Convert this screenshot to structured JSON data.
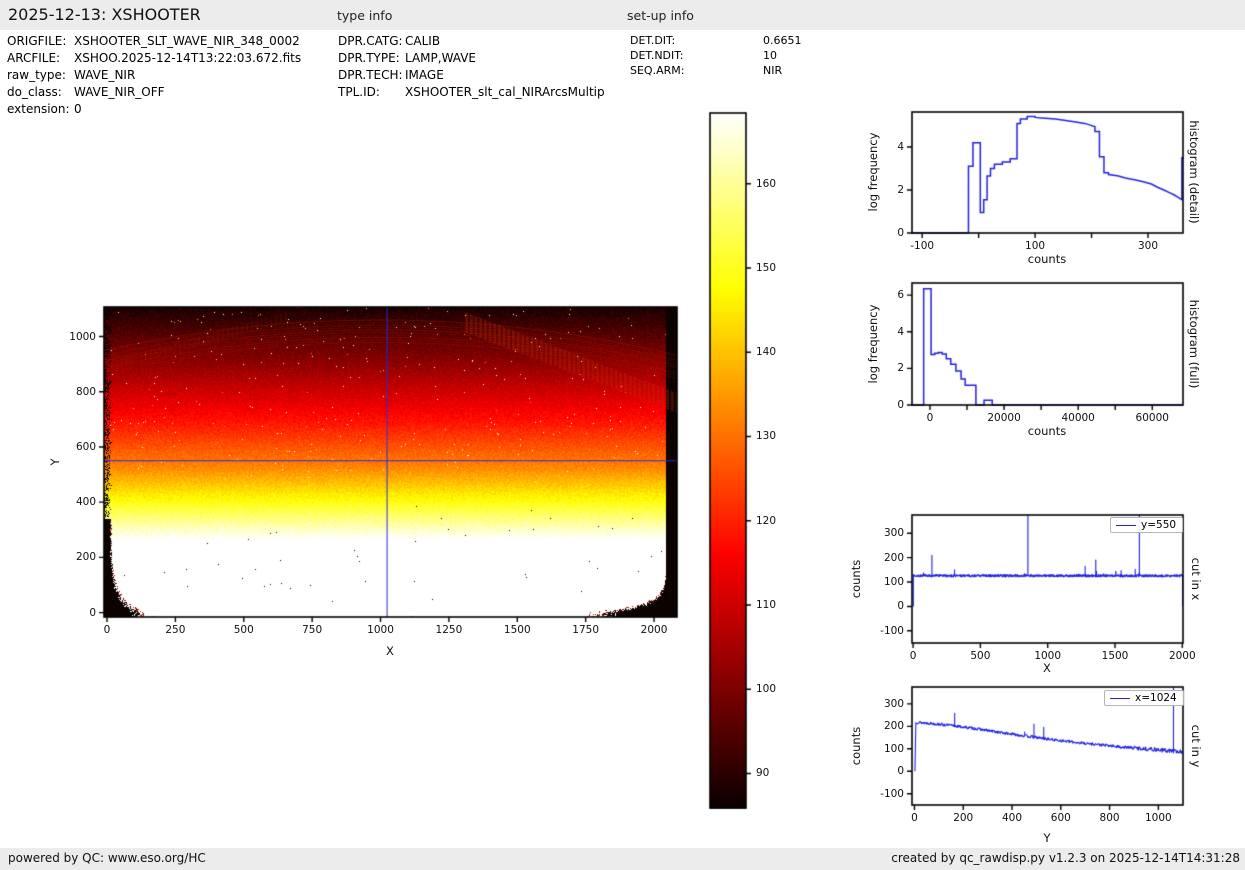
{
  "header": {
    "title": "2025-12-13: XSHOOTER",
    "type_info_title": "type info",
    "setup_info_title": "set-up info"
  },
  "file_info": {
    "rows": [
      {
        "label": "ORIGFILE:",
        "value": "XSHOOTER_SLT_WAVE_NIR_348_0002"
      },
      {
        "label": "ARCFILE:",
        "value": "XSHOO.2025-12-14T13:22:03.672.fits"
      },
      {
        "label": "raw_type:",
        "value": "WAVE_NIR"
      },
      {
        "label": "do_class:",
        "value": "WAVE_NIR_OFF"
      },
      {
        "label": "extension:",
        "value": "0"
      }
    ]
  },
  "type_info": {
    "rows": [
      {
        "label": "DPR.CATG:",
        "value": "CALIB"
      },
      {
        "label": "DPR.TYPE:",
        "value": "LAMP,WAVE"
      },
      {
        "label": "DPR.TECH:",
        "value": "IMAGE"
      },
      {
        "label": "TPL.ID:",
        "value": "XSHOOTER_slt_cal_NIRArcsMultip"
      }
    ]
  },
  "setup_info": {
    "rows": [
      {
        "label": "DET.DIT:",
        "value": "0.6651"
      },
      {
        "label": "DET.NDIT:",
        "value": "10"
      },
      {
        "label": "SEQ.ARM:",
        "value": "NIR"
      }
    ]
  },
  "footer": {
    "left": "powered by QC: www.eso.org/HC",
    "right": "created by qc_rawdisp.py v1.2.3 on 2025-12-14T14:31:28"
  },
  "colors": {
    "line_blue": "#2222dd",
    "crosshair_blue": "#2a2ae0",
    "frame_black": "#000000",
    "header_bg": "#ececec",
    "fringe_red": "#bd2509"
  },
  "chart_data": [
    {
      "id": "main-image",
      "type": "heatmap",
      "colormap": "hot",
      "xlabel": "X",
      "ylabel": "Y",
      "xlim": [
        -11,
        2084
      ],
      "ylim": [
        -16,
        1107
      ],
      "image_extent": [
        0,
        2048,
        0,
        1100
      ],
      "x_ticks": [
        0,
        250,
        500,
        750,
        1000,
        1250,
        1500,
        1750,
        2000
      ],
      "y_ticks": [
        0,
        200,
        400,
        600,
        800,
        1000
      ],
      "crosshair": {
        "x": 1024,
        "y": 550
      },
      "vmin": 85.9,
      "vmax": 168.4,
      "colorbar_ticks": [
        90,
        100,
        110,
        120,
        130,
        140,
        150,
        160
      ],
      "counts_profile_vs_y": [
        [
          0,
          218
        ],
        [
          150,
          195
        ],
        [
          270,
          168.4
        ],
        [
          410,
          147.4
        ],
        [
          520,
          133.3
        ],
        [
          680,
          119.2
        ],
        [
          900,
          102.4
        ],
        [
          1100,
          88.4
        ]
      ],
      "features": {
        "bottom_left_dead_zone": "black blob x<~100 at y=0 decaying up left edge",
        "bottom_right_dead_zone": "black blob x>~1840 at y=0 decaying up right edge",
        "left_edge_speckle_width": 16,
        "fringe_arcs_region_y": [
          940,
          1100
        ],
        "right_diagonal_band": [
          [
            1310,
            1085
          ],
          [
            2090,
            790
          ]
        ]
      }
    },
    {
      "id": "hist-detail",
      "type": "line",
      "style": "step",
      "xlabel": "counts",
      "ylabel": "log frequency",
      "side_label": "histogram (detail)",
      "xlim": [
        -118,
        362
      ],
      "ylim": [
        0,
        5.63
      ],
      "x_ticks_major": [
        -100,
        100,
        300
      ],
      "x_ticks_minor": [
        0,
        200
      ],
      "y_ticks": [
        0,
        2,
        4
      ],
      "points": [
        [
          -118,
          0
        ],
        [
          -18,
          0
        ],
        [
          -18,
          3.1
        ],
        [
          -10,
          3.1
        ],
        [
          -10,
          4.2
        ],
        [
          3,
          4.2
        ],
        [
          3,
          0.95
        ],
        [
          9,
          0.95
        ],
        [
          9,
          1.55
        ],
        [
          15,
          1.55
        ],
        [
          15,
          2.65
        ],
        [
          21,
          2.65
        ],
        [
          21,
          3.0
        ],
        [
          28,
          3.0
        ],
        [
          28,
          3.2
        ],
        [
          42,
          3.2
        ],
        [
          42,
          3.3
        ],
        [
          56,
          3.3
        ],
        [
          56,
          3.45
        ],
        [
          68,
          3.45
        ],
        [
          68,
          5.1
        ],
        [
          74,
          5.1
        ],
        [
          74,
          5.3
        ],
        [
          86,
          5.3
        ],
        [
          86,
          5.42
        ],
        [
          100,
          5.42
        ],
        [
          100,
          5.38
        ],
        [
          118,
          5.34
        ],
        [
          136,
          5.3
        ],
        [
          154,
          5.24
        ],
        [
          172,
          5.17
        ],
        [
          188,
          5.1
        ],
        [
          198,
          5.02
        ],
        [
          202,
          4.98
        ],
        [
          206,
          4.95
        ],
        [
          206,
          4.72
        ],
        [
          214,
          4.72
        ],
        [
          214,
          3.55
        ],
        [
          222,
          3.55
        ],
        [
          222,
          2.8
        ],
        [
          230,
          2.8
        ],
        [
          230,
          2.72
        ],
        [
          246,
          2.66
        ],
        [
          260,
          2.56
        ],
        [
          276,
          2.48
        ],
        [
          290,
          2.4
        ],
        [
          306,
          2.28
        ],
        [
          316,
          2.14
        ],
        [
          328,
          2.0
        ],
        [
          338,
          1.88
        ],
        [
          346,
          1.78
        ],
        [
          352,
          1.68
        ],
        [
          357,
          1.6
        ],
        [
          360,
          1.55
        ],
        [
          360,
          3.5
        ],
        [
          364,
          3.5
        ]
      ]
    },
    {
      "id": "hist-full",
      "type": "line",
      "style": "step",
      "xlabel": "counts",
      "ylabel": "log frequency",
      "side_label": "histogram (full)",
      "xlim": [
        -4850,
        68300
      ],
      "ylim": [
        0,
        6.66
      ],
      "x_ticks_major": [
        0,
        20000,
        40000,
        60000
      ],
      "x_ticks_minor": [
        10000,
        30000,
        50000
      ],
      "y_ticks": [
        0,
        2,
        4,
        6
      ],
      "points": [
        [
          -4850,
          0
        ],
        [
          -1700,
          0
        ],
        [
          -1700,
          6.35
        ],
        [
          300,
          6.35
        ],
        [
          300,
          2.75
        ],
        [
          1300,
          2.75
        ],
        [
          1300,
          2.82
        ],
        [
          2300,
          2.82
        ],
        [
          2300,
          2.87
        ],
        [
          3300,
          2.87
        ],
        [
          3300,
          2.78
        ],
        [
          4400,
          2.78
        ],
        [
          4400,
          2.52
        ],
        [
          5600,
          2.52
        ],
        [
          5600,
          2.22
        ],
        [
          7000,
          2.22
        ],
        [
          7000,
          1.86
        ],
        [
          8400,
          1.86
        ],
        [
          8400,
          1.42
        ],
        [
          9500,
          1.42
        ],
        [
          9500,
          1.08
        ],
        [
          12400,
          1.08
        ],
        [
          12400,
          0
        ],
        [
          14600,
          0
        ],
        [
          14600,
          0.26
        ],
        [
          16800,
          0.26
        ],
        [
          16800,
          0
        ],
        [
          68300,
          0
        ]
      ]
    },
    {
      "id": "cut-x",
      "type": "line",
      "legend": "y=550",
      "xlabel": "X",
      "ylabel": "counts",
      "side_label": "cut in x",
      "xlim": [
        -8,
        2005
      ],
      "ylim": [
        -150,
        375
      ],
      "x_ticks_major": [
        0,
        500,
        1000,
        1500,
        2000
      ],
      "x_ticks_minor": [],
      "y_ticks": [
        -100,
        0,
        100,
        200,
        300
      ],
      "baseline": 126,
      "noise_amp": 5,
      "x_range": [
        2,
        2002
      ],
      "spikes": [
        [
          140,
          210
        ],
        [
          308,
          150
        ],
        [
          853,
          520
        ],
        [
          1278,
          165
        ],
        [
          1357,
          190
        ],
        [
          1545,
          147
        ],
        [
          1650,
          152
        ],
        [
          1681,
          520
        ]
      ]
    },
    {
      "id": "cut-y",
      "type": "line",
      "legend": "x=1024",
      "xlabel": "Y",
      "ylabel": "counts",
      "side_label": "cut in y",
      "xlim": [
        -10,
        1101
      ],
      "ylim": [
        -150,
        375
      ],
      "x_ticks_major": [
        0,
        200,
        400,
        600,
        800,
        1000
      ],
      "x_ticks_minor": [],
      "y_ticks": [
        -100,
        0,
        100,
        200,
        300
      ],
      "noise_amp": 6,
      "trend": [
        [
          2,
          0
        ],
        [
          6,
          218
        ],
        [
          60,
          214
        ],
        [
          150,
          204
        ],
        [
          250,
          190
        ],
        [
          350,
          173
        ],
        [
          450,
          158
        ],
        [
          550,
          143
        ],
        [
          650,
          130
        ],
        [
          750,
          119
        ],
        [
          850,
          108
        ],
        [
          950,
          100
        ],
        [
          1050,
          91
        ],
        [
          1098,
          86
        ]
      ],
      "spikes": [
        [
          165,
          258
        ],
        [
          452,
          175
        ],
        [
          490,
          210
        ],
        [
          530,
          196
        ],
        [
          1062,
          520
        ]
      ]
    }
  ]
}
